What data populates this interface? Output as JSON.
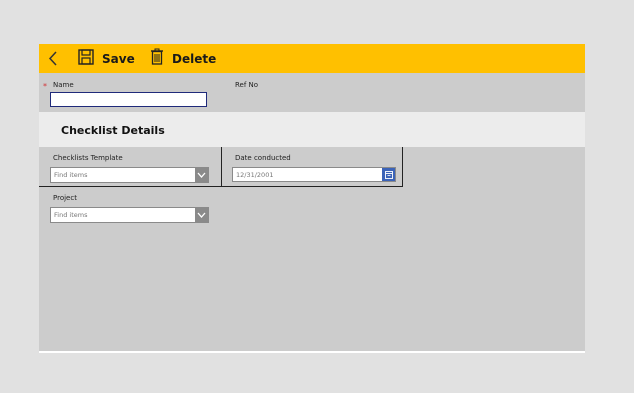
{
  "toolbar": {
    "save_label": "Save",
    "delete_label": "Delete",
    "accent": "#ffc000"
  },
  "form": {
    "name_label": "Name",
    "name_required_marker": "*",
    "name_value": "",
    "refno_label": "Ref No",
    "section_title": "Checklist Details",
    "checklists_template_label": "Checklists Template",
    "checklists_template_placeholder": "Find items",
    "date_conducted_label": "Date conducted",
    "date_conducted_value": "12/31/2001",
    "project_label": "Project",
    "project_placeholder": "Find items"
  },
  "icons": {
    "back": "back-chevron-icon",
    "save": "floppy-disk-icon",
    "delete": "trash-icon",
    "dropdown": "chevron-down-icon",
    "calendar": "calendar-icon"
  }
}
